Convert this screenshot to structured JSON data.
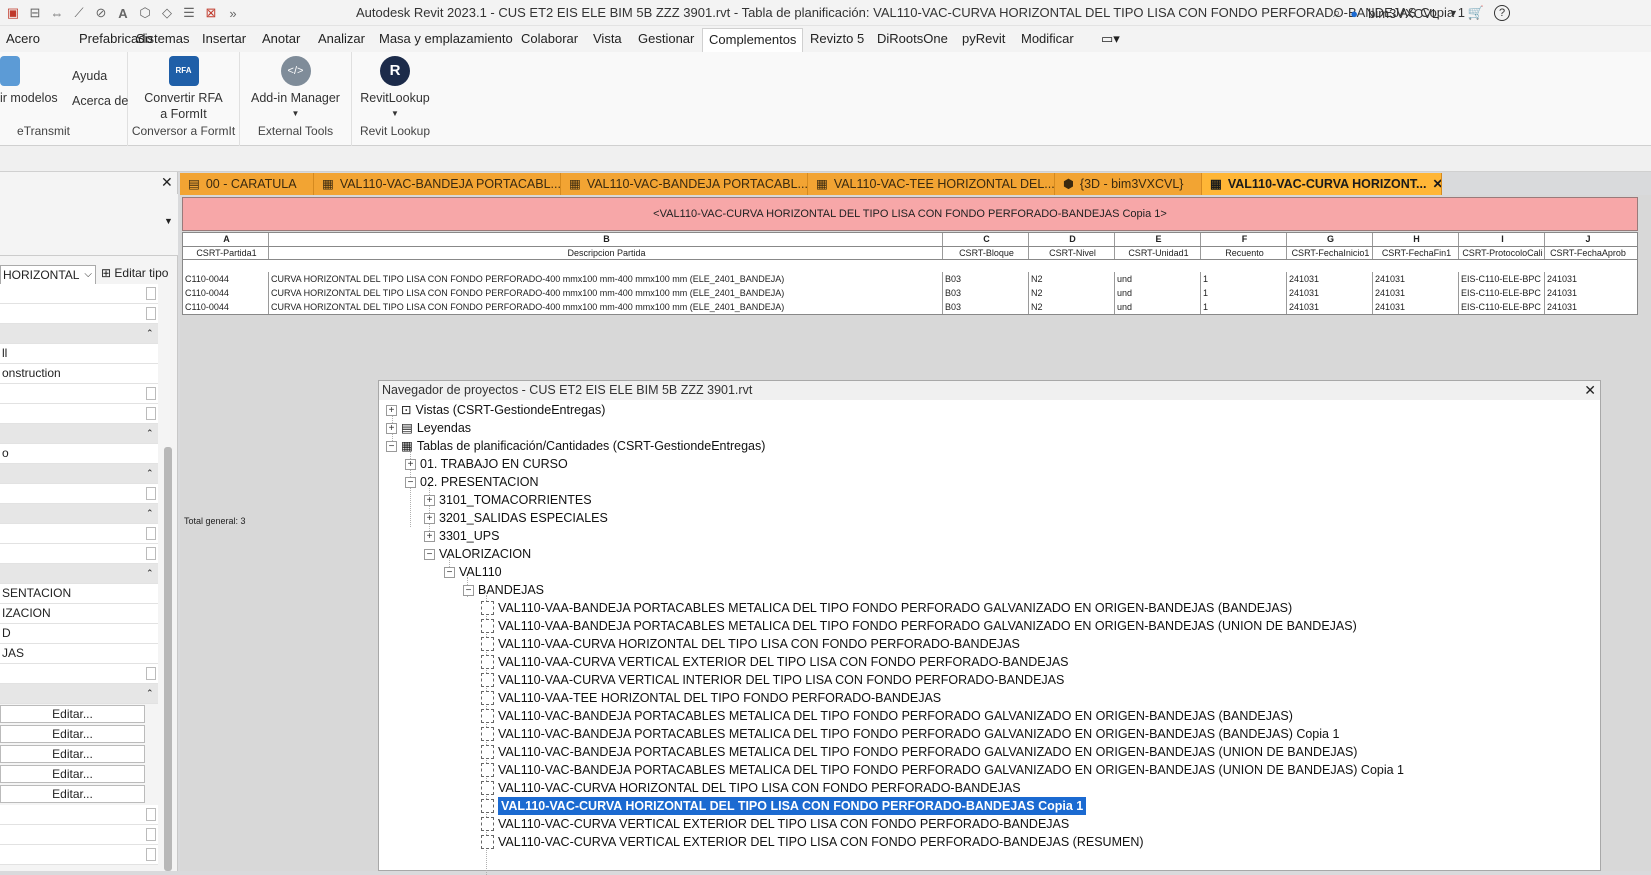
{
  "window": {
    "title": "Autodesk Revit 2023.1 - CUS ET2 EIS ELE BIM 5B ZZZ 3901.rvt - Tabla de planificación: VAL110-VAC-CURVA HORIZONTAL DEL TIPO LISA CON FONDO PERFORADO-BANDEJAS Copia 1",
    "user": "bim3VXCVL"
  },
  "menu": {
    "tabs": [
      "Acero",
      "Prefabricado",
      "Sistemas",
      "Insertar",
      "Anotar",
      "Analizar",
      "Masa y emplazamiento",
      "Colaborar",
      "Vista",
      "Gestionar",
      "Complementos",
      "Revizto 5",
      "DiRootsOne",
      "pyRevit",
      "Modificar"
    ],
    "active": "Complementos"
  },
  "ribbon": {
    "etransmit": {
      "btn1": "ir modelos",
      "btn2": "Ayuda",
      "btn3": "Acerca de",
      "label": "eTransmit"
    },
    "formit": {
      "btn_line1": "Convertir RFA",
      "btn_line2": "a FormIt",
      "icon_text": "RFA",
      "label": "Conversor a FormIt"
    },
    "external": {
      "btn": "Add-in Manager",
      "label": "External Tools"
    },
    "lookup": {
      "btn": "RevitLookup",
      "icon_text": "R",
      "label": "Revit Lookup"
    }
  },
  "properties": {
    "type_selector": "HORIZONTAL",
    "edit_type": "Editar tipo",
    "rows": [
      "ll",
      "onstruction",
      "o",
      "SENTACION",
      "IZACION",
      "D",
      "JAS"
    ],
    "edit_label": "Editar..."
  },
  "view_tabs": [
    {
      "label": "00 - CARATULA"
    },
    {
      "label": "VAL110-VAC-BANDEJA PORTACABL..."
    },
    {
      "label": "VAL110-VAC-BANDEJA PORTACABL..."
    },
    {
      "label": "VAL110-VAC-TEE HORIZONTAL DEL..."
    },
    {
      "label": "{3D - bim3VXCVL}"
    },
    {
      "label": "VAL110-VAC-CURVA HORIZONT..."
    }
  ],
  "schedule": {
    "title": "<VAL110-VAC-CURVA HORIZONTAL DEL TIPO LISA CON FONDO PERFORADO-BANDEJAS Copia 1>",
    "letters": [
      "A",
      "B",
      "C",
      "D",
      "E",
      "F",
      "G",
      "H",
      "I",
      "J"
    ],
    "headers": [
      "CSRT-Partida1",
      "Descripcion Partida",
      "CSRT-Bloque",
      "CSRT-Nivel",
      "CSRT-Unidad1",
      "Recuento",
      "CSRT-FechaInicio1",
      "CSRT-FechaFin1",
      "CSRT-ProtocoloCali",
      "CSRT-FechaAprob"
    ],
    "rows": [
      [
        "C110-0044",
        "CURVA HORIZONTAL DEL TIPO LISA CON FONDO PERFORADO-400 mmx100 mm-400 mmx100 mm (ELE_2401_BANDEJA)",
        "B03",
        "N2",
        "und",
        "1",
        "241031",
        "241031",
        "EIS-C110-ELE-BPC",
        "241031"
      ],
      [
        "C110-0044",
        "CURVA HORIZONTAL DEL TIPO LISA CON FONDO PERFORADO-400 mmx100 mm-400 mmx100 mm (ELE_2401_BANDEJA)",
        "B03",
        "N2",
        "und",
        "1",
        "241031",
        "241031",
        "EIS-C110-ELE-BPC",
        "241031"
      ],
      [
        "C110-0044",
        "CURVA HORIZONTAL DEL TIPO LISA CON FONDO PERFORADO-400 mmx100 mm-400 mmx100 mm (ELE_2401_BANDEJA)",
        "B03",
        "N2",
        "und",
        "1",
        "241031",
        "241031",
        "EIS-C110-ELE-BPC",
        "241031"
      ]
    ],
    "total_label": "Total general: 3",
    "total_count": "3"
  },
  "browser": {
    "title": "Navegador de proyectos - CUS ET2 EIS ELE BIM 5B ZZZ 3901.rvt",
    "nodes": {
      "vistas": "Vistas (CSRT-GestiondeEntregas)",
      "leyendas": "Leyendas",
      "tablas": "Tablas de planificación/Cantidades (CSRT-GestiondeEntregas)",
      "trabajo": "01. TRABAJO EN CURSO",
      "presentacion": "02. PRESENTACION",
      "toma": "3101_TOMACORRIENTES",
      "salidas": "3201_SALIDAS ESPECIALES",
      "ups": "3301_UPS",
      "valorizacion": "VALORIZACION",
      "val110": "VAL110",
      "bandejas": "BANDEJAS"
    },
    "schedules": [
      "VAL110-VAA-BANDEJA PORTACABLES METALICA DEL TIPO FONDO PERFORADO GALVANIZADO EN ORIGEN-BANDEJAS (BANDEJAS)",
      "VAL110-VAA-BANDEJA PORTACABLES METALICA DEL TIPO FONDO PERFORADO GALVANIZADO EN ORIGEN-BANDEJAS (UNION DE BANDEJAS)",
      "VAL110-VAA-CURVA HORIZONTAL DEL TIPO LISA CON FONDO PERFORADO-BANDEJAS",
      "VAL110-VAA-CURVA VERTICAL EXTERIOR DEL TIPO LISA CON FONDO PERFORADO-BANDEJAS",
      "VAL110-VAA-CURVA VERTICAL INTERIOR DEL TIPO LISA CON FONDO PERFORADO-BANDEJAS",
      "VAL110-VAA-TEE HORIZONTAL DEL TIPO FONDO PERFORADO-BANDEJAS",
      "VAL110-VAC-BANDEJA PORTACABLES METALICA DEL TIPO FONDO PERFORADO GALVANIZADO EN ORIGEN-BANDEJAS (BANDEJAS)",
      "VAL110-VAC-BANDEJA PORTACABLES METALICA DEL TIPO FONDO PERFORADO GALVANIZADO EN ORIGEN-BANDEJAS (BANDEJAS) Copia 1",
      "VAL110-VAC-BANDEJA PORTACABLES METALICA DEL TIPO FONDO PERFORADO GALVANIZADO EN ORIGEN-BANDEJAS (UNION DE BANDEJAS)",
      "VAL110-VAC-BANDEJA PORTACABLES METALICA DEL TIPO FONDO PERFORADO GALVANIZADO EN ORIGEN-BANDEJAS (UNION DE BANDEJAS) Copia 1",
      "VAL110-VAC-CURVA HORIZONTAL DEL TIPO LISA CON FONDO PERFORADO-BANDEJAS",
      "VAL110-VAC-CURVA HORIZONTAL DEL TIPO LISA CON FONDO PERFORADO-BANDEJAS Copia 1",
      "VAL110-VAC-CURVA VERTICAL EXTERIOR DEL TIPO LISA CON FONDO PERFORADO-BANDEJAS",
      "VAL110-VAC-CURVA VERTICAL EXTERIOR DEL TIPO LISA CON FONDO PERFORADO-BANDEJAS (RESUMEN)"
    ],
    "selected_index": 11
  },
  "colors": {
    "tab_orange": "#f2a433",
    "schedule_title_bg": "#f7a7a8",
    "selection_blue": "#1b6ad1",
    "highlight_red": "#e01010"
  }
}
